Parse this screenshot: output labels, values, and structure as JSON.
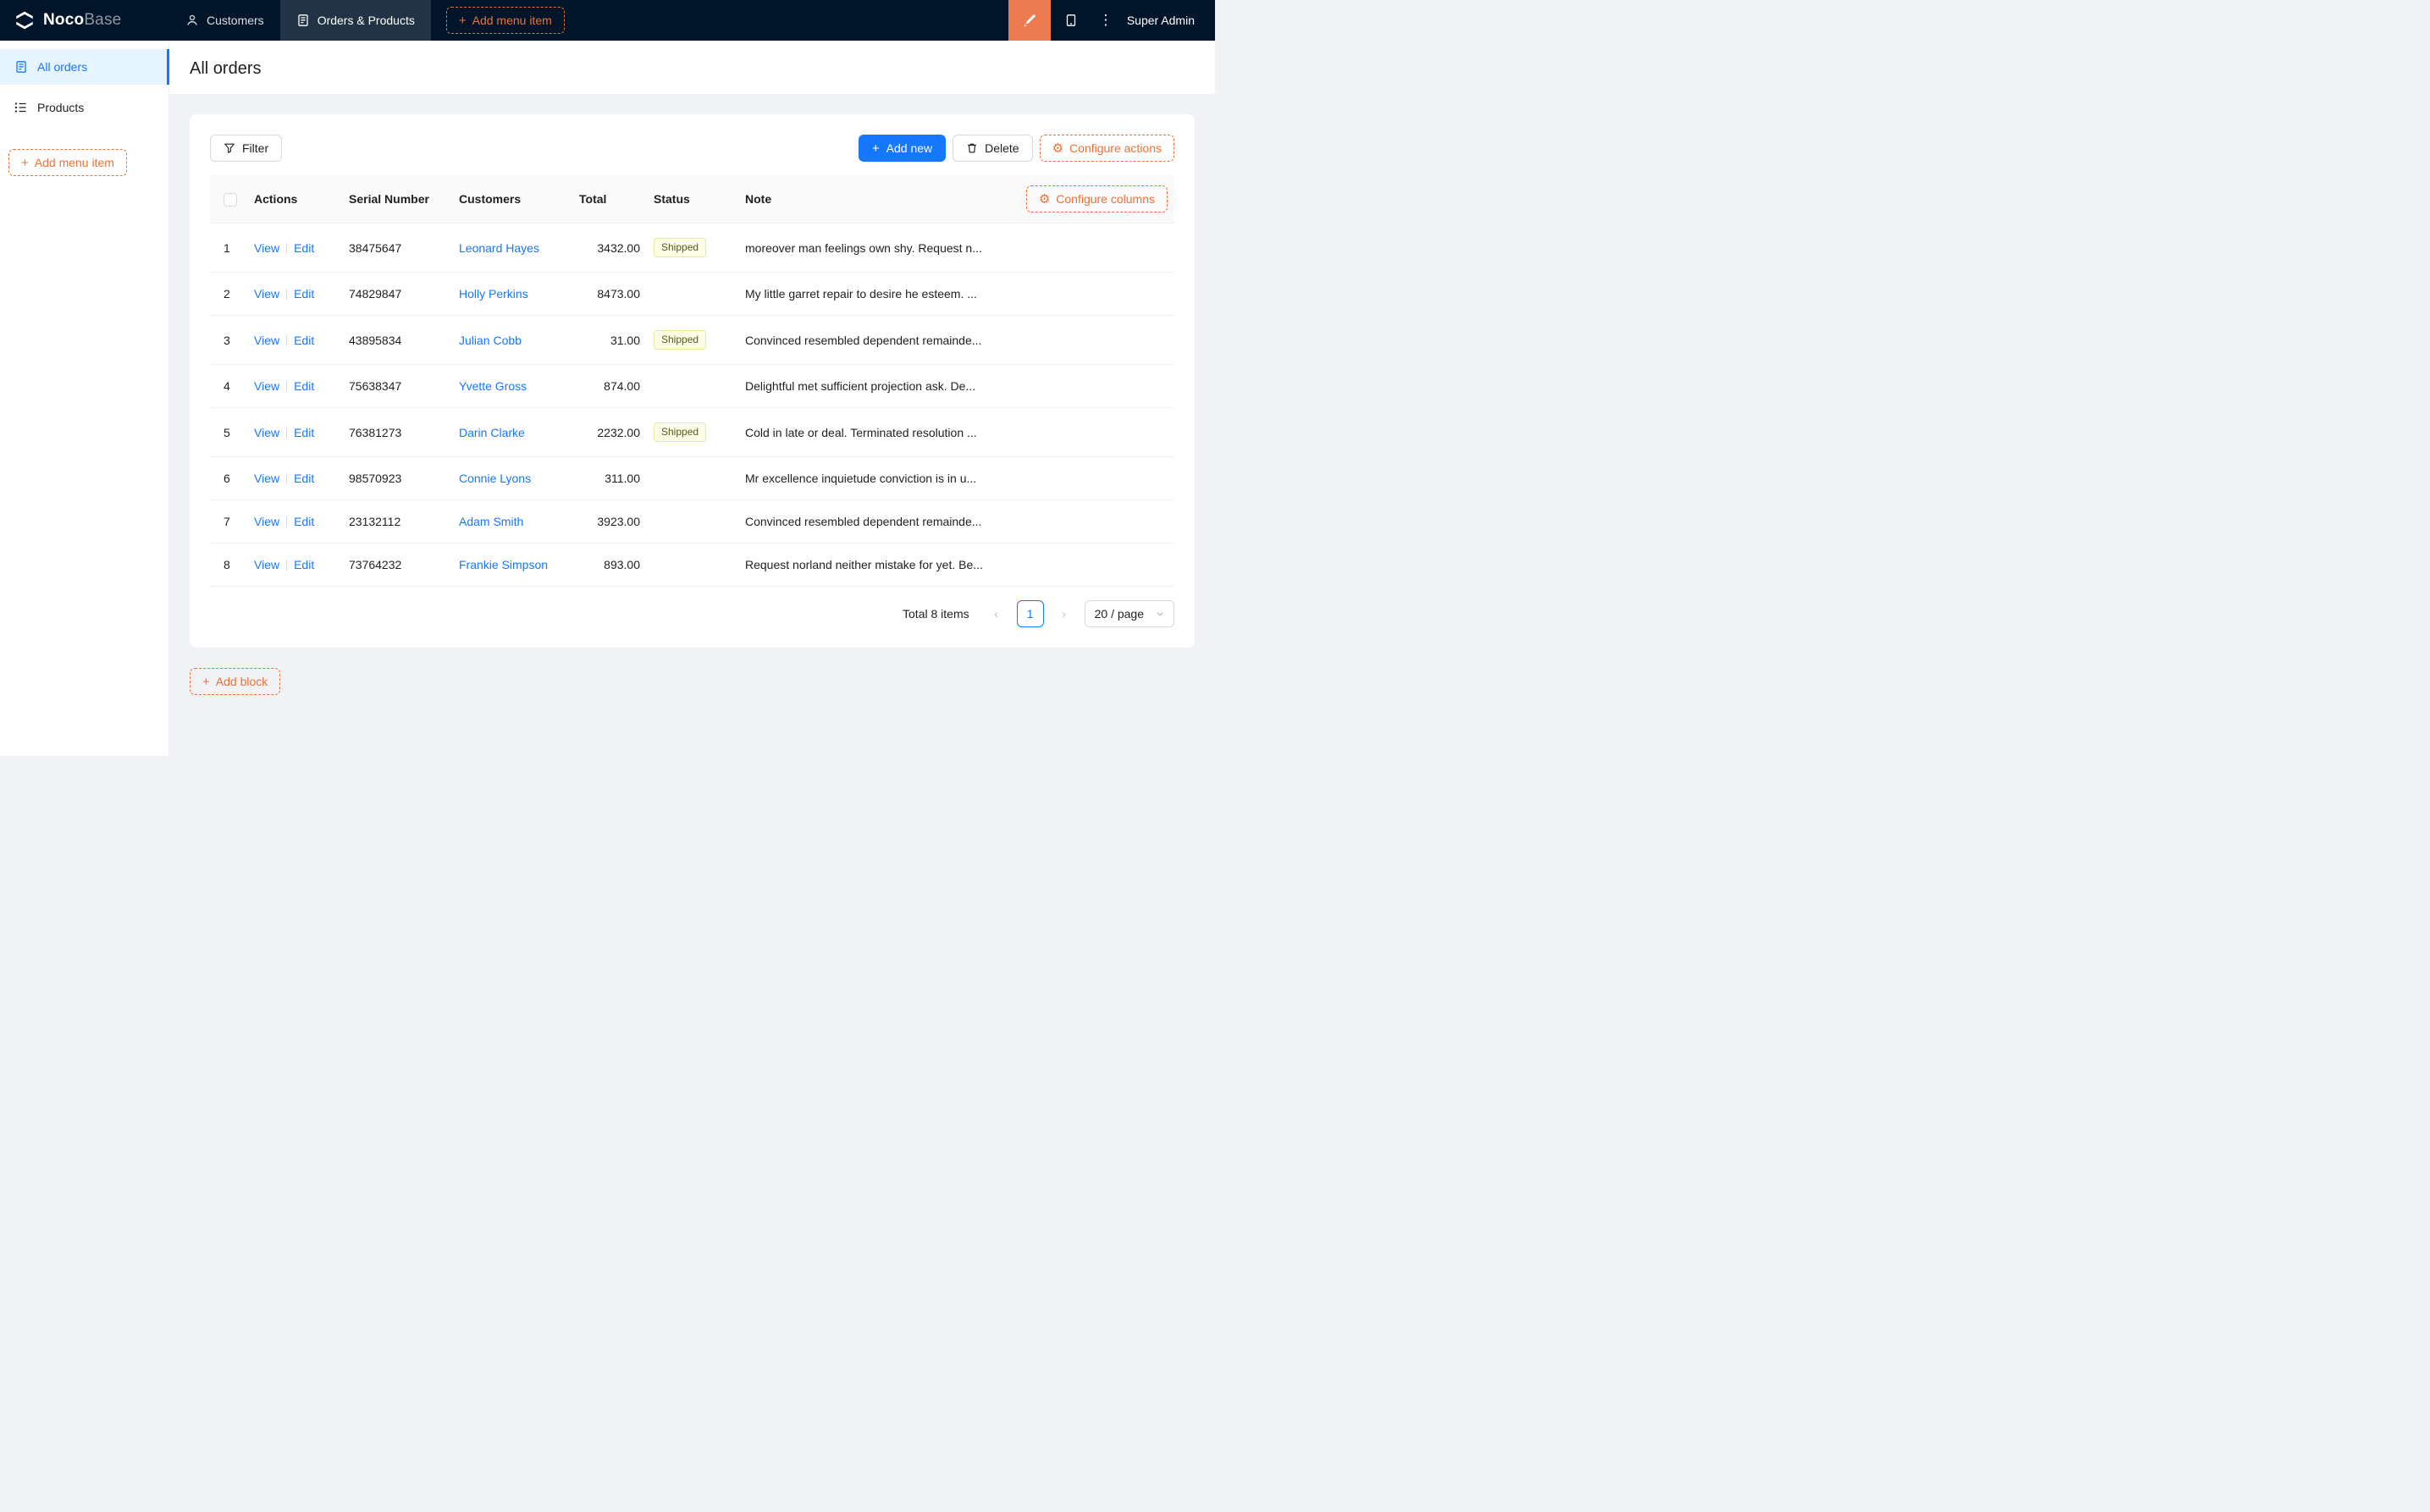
{
  "colors": {
    "header_bg": "#001529",
    "designer_orange": "#ed7d51",
    "accent_orange": "#ee7135",
    "primary_blue": "#1677ff",
    "sidebar_active_bg": "#e6f4ff",
    "page_bg": "#f0f2f5",
    "table_border": "#f0f0f0",
    "tag_bg": "#fcffe6",
    "tag_border": "#e3ec9a"
  },
  "icons": {
    "plus": "+",
    "kebab": "⋮",
    "gear": "⚙",
    "prev_arrow": "‹",
    "next_arrow": "›"
  },
  "header": {
    "logo_bold": "Noco",
    "logo_light": "Base",
    "nav": [
      {
        "label": "Customers"
      },
      {
        "label": "Orders & Products"
      }
    ],
    "add_menu_item_label": "Add menu item",
    "user": "Super Admin"
  },
  "sidebar": {
    "items": [
      {
        "label": "All orders"
      },
      {
        "label": "Products"
      }
    ],
    "add_menu_item_label": "Add menu item"
  },
  "page": {
    "title": "All orders"
  },
  "toolbar": {
    "filter_label": "Filter",
    "add_new_label": "Add new",
    "delete_label": "Delete",
    "configure_actions_label": "Configure actions"
  },
  "table": {
    "columns": [
      "Actions",
      "Serial Number",
      "Customers",
      "Total",
      "Status",
      "Note"
    ],
    "configure_columns_label": "Configure columns",
    "action_labels": {
      "view": "View",
      "edit": "Edit"
    },
    "rows": [
      {
        "index": "1",
        "serial": "38475647",
        "customer": "Leonard Hayes",
        "total": "3432.00",
        "status": "Shipped",
        "note": "moreover man feelings own shy. Request n..."
      },
      {
        "index": "2",
        "serial": "74829847",
        "customer": "Holly Perkins",
        "total": "8473.00",
        "status": "",
        "note": "My little garret repair to desire he esteem. ..."
      },
      {
        "index": "3",
        "serial": "43895834",
        "customer": "Julian Cobb",
        "total": "31.00",
        "status": "Shipped",
        "note": "Convinced resembled dependent remainde..."
      },
      {
        "index": "4",
        "serial": "75638347",
        "customer": "Yvette Gross",
        "total": "874.00",
        "status": "",
        "note": "Delightful met sufficient projection ask. De..."
      },
      {
        "index": "5",
        "serial": "76381273",
        "customer": "Darin Clarke",
        "total": "2232.00",
        "status": "Shipped",
        "note": "Cold in late or deal. Terminated resolution ..."
      },
      {
        "index": "6",
        "serial": "98570923",
        "customer": "Connie Lyons",
        "total": "311.00",
        "status": "",
        "note": "Mr excellence inquietude conviction is in u..."
      },
      {
        "index": "7",
        "serial": "23132112",
        "customer": "Adam Smith",
        "total": "3923.00",
        "status": "",
        "note": "Convinced resembled dependent remainde..."
      },
      {
        "index": "8",
        "serial": "73764232",
        "customer": "Frankie Simpson",
        "total": "893.00",
        "status": "",
        "note": "Request norland neither mistake for yet. Be..."
      }
    ]
  },
  "pagination": {
    "total_text": "Total 8 items",
    "current_page": "1",
    "page_size": "20 / page"
  },
  "footer": {
    "add_block_label": "Add block"
  }
}
